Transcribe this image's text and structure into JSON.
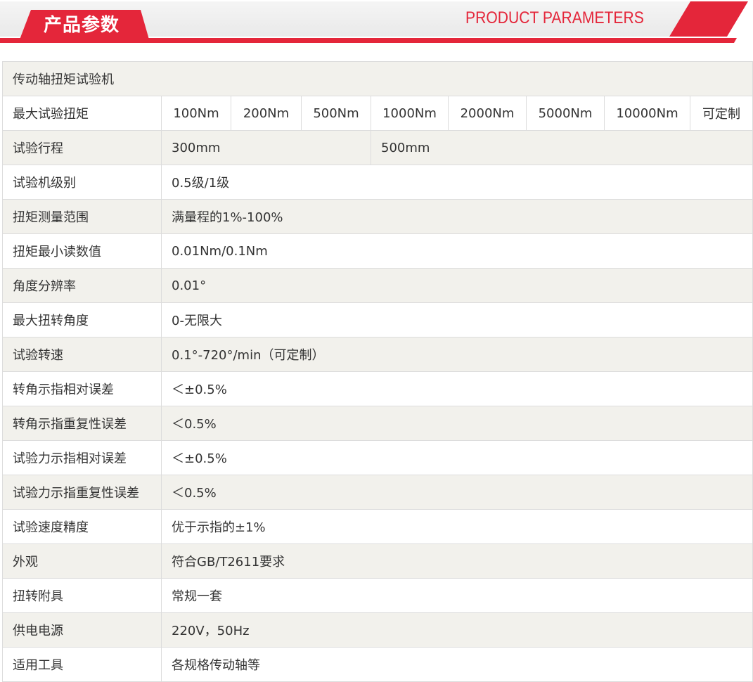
{
  "banner": {
    "title_cn": "产品参数",
    "title_en": "PRODUCT PARAMETERS",
    "accent_color": "#e4263a"
  },
  "table": {
    "caption": "传动轴扭矩试验机",
    "max_torque": {
      "label": "最大试验扭矩",
      "values": [
        "100Nm",
        "200Nm",
        "500Nm",
        "1000Nm",
        "2000Nm",
        "5000Nm",
        "10000Nm",
        "可定制"
      ]
    },
    "stroke": {
      "label": "试验行程",
      "values": [
        "300mm",
        "500mm"
      ]
    },
    "rows": [
      {
        "label": "试验机级别",
        "value": "0.5级/1级"
      },
      {
        "label": "扭矩测量范围",
        "value": "满量程的1%-100%"
      },
      {
        "label": "扭矩最小读数值",
        "value": "0.01Nm/0.1Nm"
      },
      {
        "label": "角度分辨率",
        "value": "0.01°"
      },
      {
        "label": "最大扭转角度",
        "value": "0-无限大"
      },
      {
        "label": "试验转速",
        "value": "0.1°-720°/min（可定制）"
      },
      {
        "label": "转角示指相对误差",
        "value": "＜±0.5%"
      },
      {
        "label": "转角示指重复性误差",
        "value": "＜0.5%"
      },
      {
        "label": "试验力示指相对误差",
        "value": "＜±0.5%"
      },
      {
        "label": "试验力示指重复性误差",
        "value": "＜0.5%"
      },
      {
        "label": "试验速度精度",
        "value": "优于示指的±1%"
      },
      {
        "label": "外观",
        "value": "符合GB/T2611要求"
      },
      {
        "label": "扭转附具",
        "value": "常规一套"
      },
      {
        "label": "供电电源",
        "value": "220V，50Hz"
      },
      {
        "label": "适用工具",
        "value": "各规格传动轴等"
      }
    ]
  }
}
